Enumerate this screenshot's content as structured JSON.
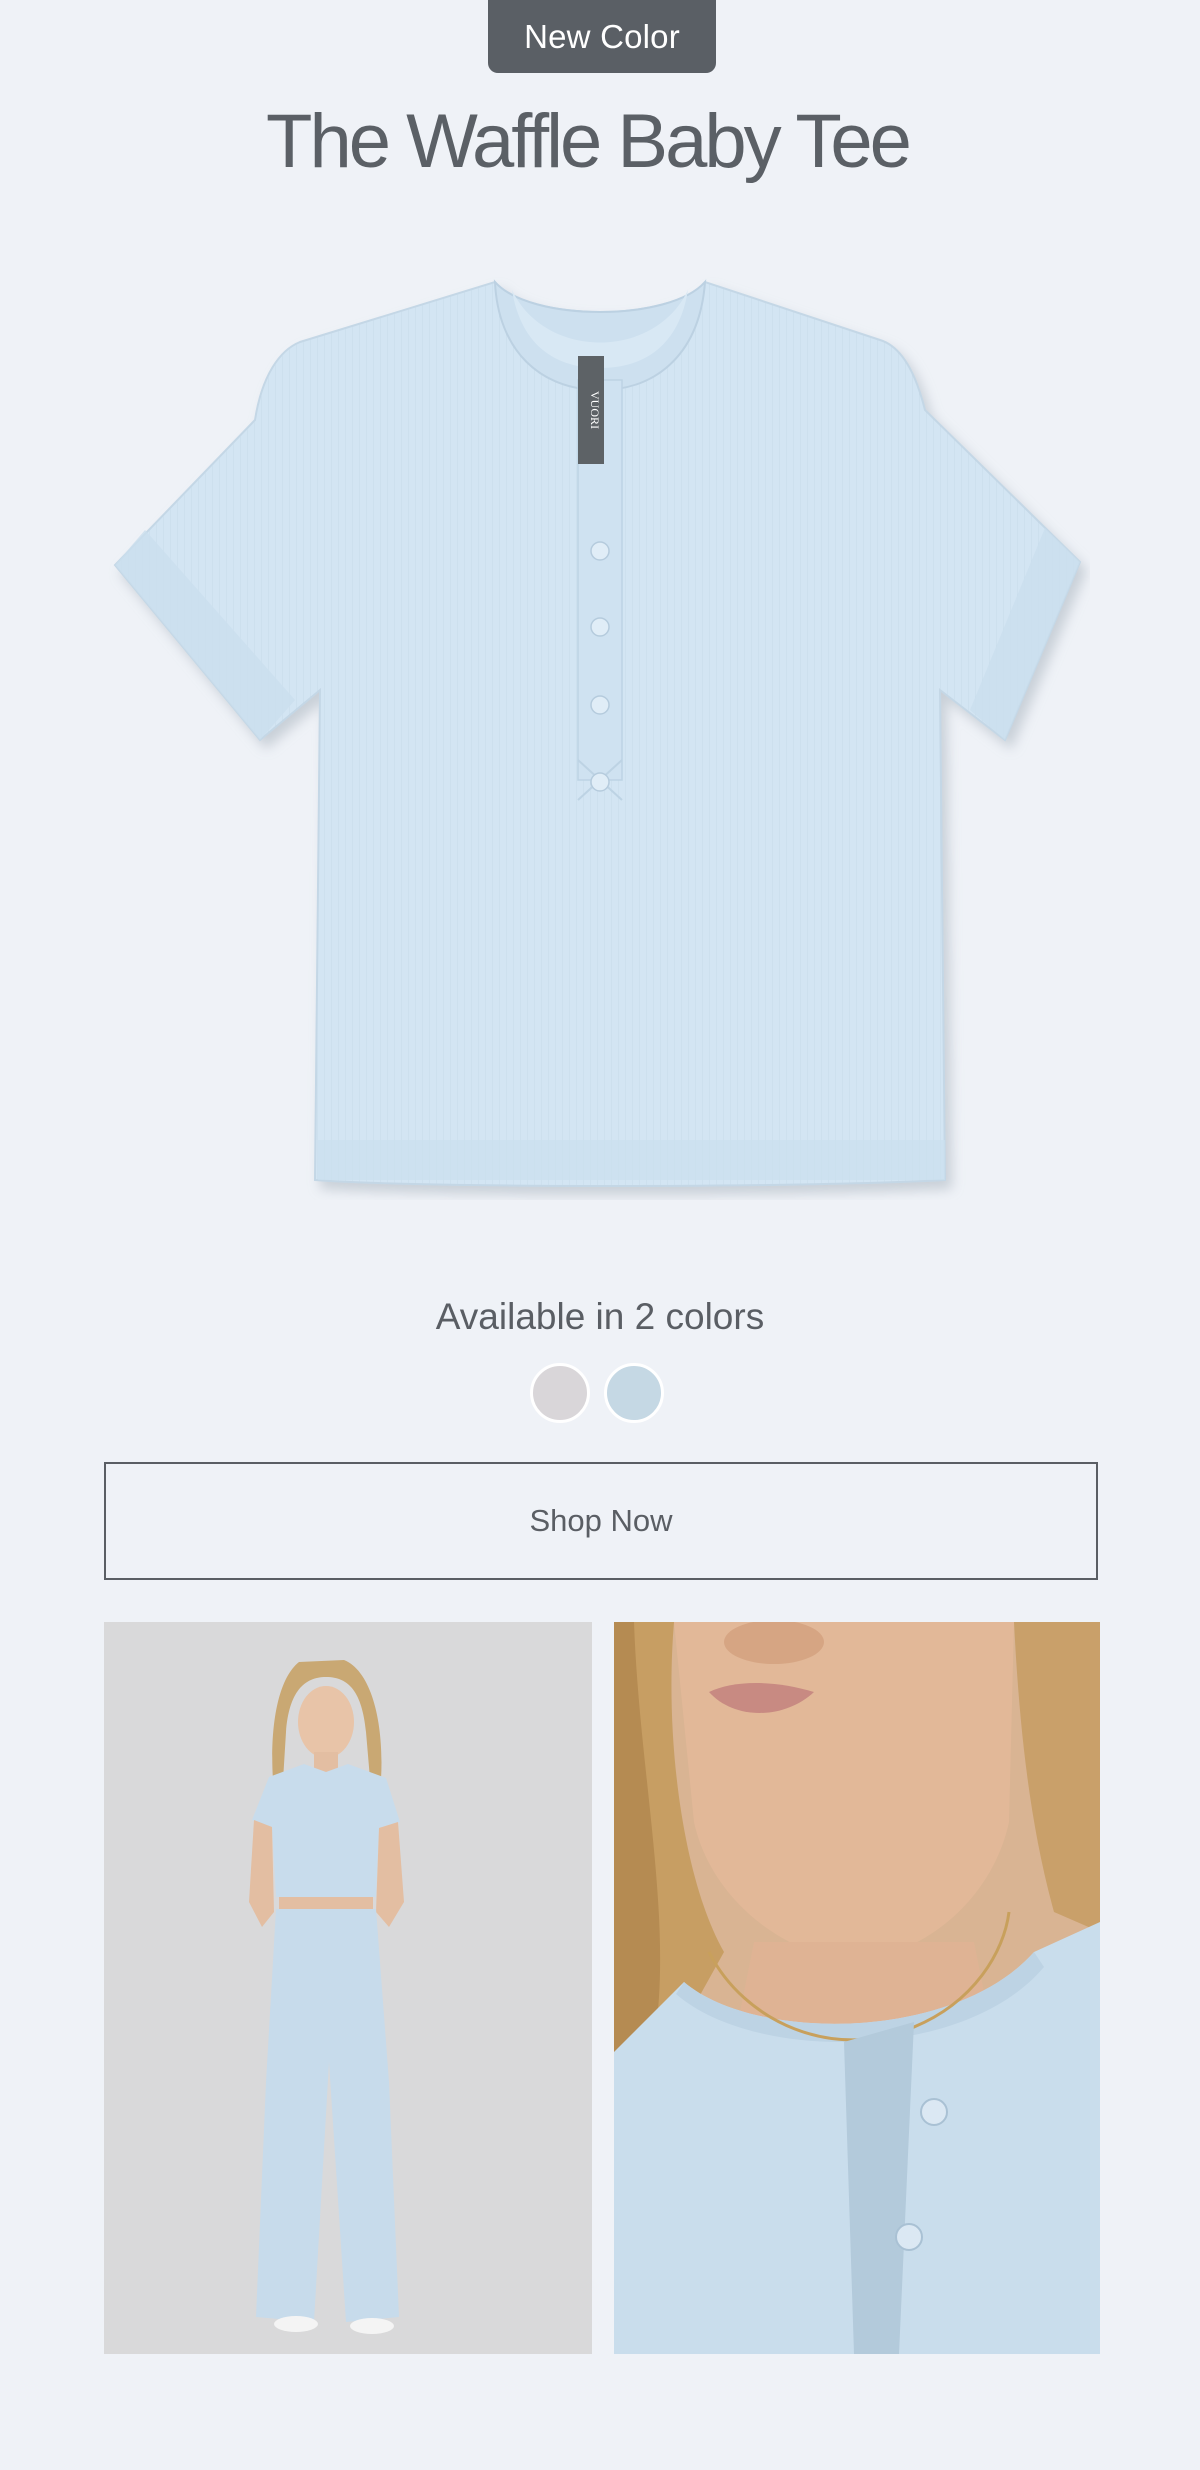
{
  "badge": {
    "label": "New Color"
  },
  "product": {
    "title": "The Waffle Baby Tee",
    "tag_brand": "VUORI"
  },
  "colors": {
    "label": "Available in 2 colors",
    "swatches": [
      {
        "name": "swatch-1",
        "hex": "#d9d6d9"
      },
      {
        "name": "swatch-2",
        "hex": "#c5d8e4"
      }
    ]
  },
  "cta": {
    "label": "Shop Now"
  },
  "palette": {
    "background": "#eff2f7",
    "tee": "#d3e5f3",
    "text": "#575c62"
  }
}
